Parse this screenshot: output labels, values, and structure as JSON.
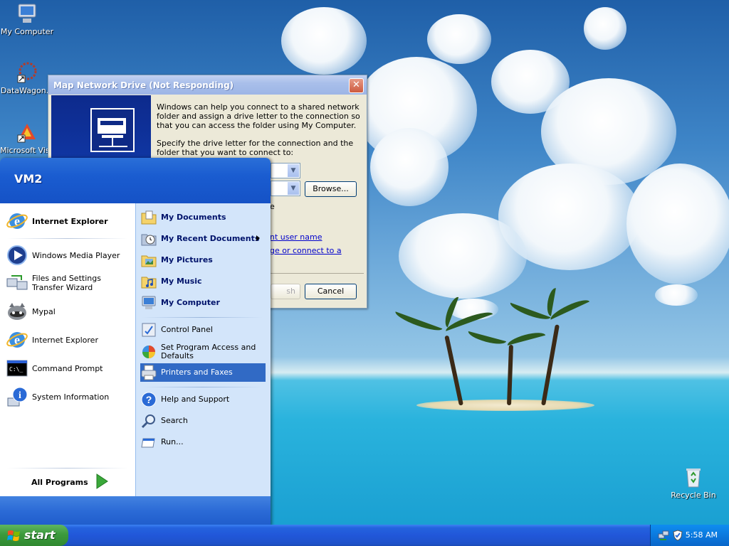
{
  "desktop": {
    "icons": [
      {
        "label": "My Computer",
        "icon": "my-computer-icon"
      },
      {
        "label": "DataWagon...",
        "icon": "datawagon-icon"
      },
      {
        "label": "Microsoft Visu",
        "icon": "visual-studio-icon"
      },
      {
        "label": "Recycle Bin",
        "icon": "recycle-bin-icon"
      }
    ]
  },
  "dialog": {
    "title": "Map Network Drive (Not Responding)",
    "paragraph1": "Windows can help you connect to a shared network folder and assign a drive letter to the connection so that you can access the folder using My Computer.",
    "paragraph2": "Specify the drive letter for the connection and the folder that you want to connect to:",
    "browse_label": "Browse...",
    "cancel_label": "Cancel",
    "finish_label_visible": "sh",
    "partial_text_e": "e",
    "link1_visible": "nt user name",
    "link2_visible": "ge or connect to a",
    "close_glyph": "✕"
  },
  "start_menu": {
    "user": "VM2",
    "left_items": [
      {
        "label": "Internet Explorer",
        "icon": "internet-explorer-icon",
        "bold": true
      },
      {
        "label": "Windows Media Player",
        "icon": "media-player-icon",
        "bold": false
      },
      {
        "label": "Files and Settings Transfer Wizard",
        "icon": "transfer-wizard-icon",
        "bold": false
      },
      {
        "label": "Mypal",
        "icon": "mypal-icon",
        "bold": false
      },
      {
        "label": "Internet Explorer",
        "icon": "internet-explorer-icon",
        "bold": false
      },
      {
        "label": "Command Prompt",
        "icon": "command-prompt-icon",
        "bold": false
      },
      {
        "label": "System Information",
        "icon": "system-information-icon",
        "bold": false
      }
    ],
    "all_programs": "All Programs",
    "right_items": [
      {
        "label": "My Documents",
        "icon": "my-documents-icon"
      },
      {
        "label": "My Recent Documents",
        "icon": "recent-documents-icon"
      },
      {
        "label": "My Pictures",
        "icon": "my-pictures-icon"
      },
      {
        "label": "My Music",
        "icon": "my-music-icon"
      },
      {
        "label": "My Computer",
        "icon": "my-computer-icon"
      },
      {
        "label": "Control Panel",
        "icon": "control-panel-icon"
      },
      {
        "label": "Set Program Access and Defaults",
        "icon": "program-access-icon"
      },
      {
        "label": "Printers and Faxes",
        "icon": "printer-icon"
      },
      {
        "label": "Help and Support",
        "icon": "help-icon"
      },
      {
        "label": "Search",
        "icon": "search-icon"
      },
      {
        "label": "Run...",
        "icon": "run-icon"
      }
    ],
    "highlighted_item": "Printers and Faxes"
  },
  "taskbar": {
    "start_label": "start",
    "clock": "5:58 AM",
    "tray_icons": [
      "network-icon",
      "security-shield-icon"
    ]
  },
  "colors": {
    "taskbar_blue": "#2157d9",
    "start_green": "#3c9a3c",
    "menu_header_blue": "#1a5cd0",
    "menu_highlight": "#316ac5",
    "dialog_face": "#ece9d8"
  }
}
